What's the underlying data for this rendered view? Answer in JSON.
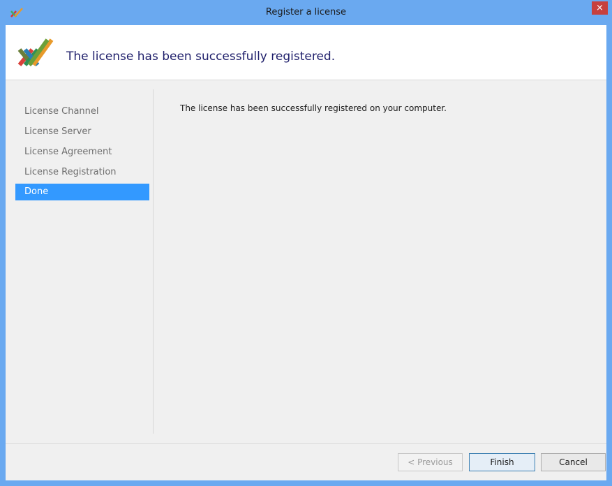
{
  "window": {
    "title": "Register a license",
    "close_label": "×"
  },
  "header": {
    "title": "The license has been successfully registered."
  },
  "steps": [
    {
      "label": "License Channel"
    },
    {
      "label": "License Server"
    },
    {
      "label": "License Agreement"
    },
    {
      "label": "License Registration"
    },
    {
      "label": "Done"
    }
  ],
  "content": {
    "message": "The license has been successfully registered on your computer."
  },
  "buttons": {
    "previous": "< Previous",
    "finish": "Finish",
    "cancel": "Cancel"
  },
  "colors": {
    "titlebar": "#6aa9f0",
    "accent": "#3399ff",
    "close": "#c7403d"
  }
}
